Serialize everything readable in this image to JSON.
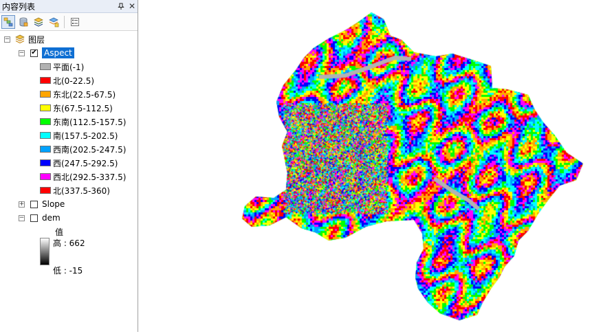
{
  "panel": {
    "title": "内容列表",
    "pin_icon": "pin-icon",
    "close_icon": "close-icon"
  },
  "toolbar": {
    "buttons": [
      {
        "name": "list-by-drawing-order",
        "icon": "drawing-order-icon",
        "active": true
      },
      {
        "name": "list-by-source",
        "icon": "source-icon",
        "active": false
      },
      {
        "name": "list-by-visibility",
        "icon": "visibility-icon",
        "active": false
      },
      {
        "name": "list-by-selection",
        "icon": "selection-icon",
        "active": false
      },
      {
        "name": "options",
        "icon": "options-icon",
        "active": false
      }
    ]
  },
  "tree": {
    "root": {
      "label": "图层",
      "expanded": true
    },
    "layers": [
      {
        "name": "Aspect",
        "checked": true,
        "expanded": true,
        "selected": true,
        "classes": [
          {
            "label": "平面(-1)",
            "color": "#b2b2b2"
          },
          {
            "label": "北(0-22.5)",
            "color": "#ff0000"
          },
          {
            "label": "东北(22.5-67.5)",
            "color": "#ffa500"
          },
          {
            "label": "东(67.5-112.5)",
            "color": "#ffff00"
          },
          {
            "label": "东南(112.5-157.5)",
            "color": "#00ff00"
          },
          {
            "label": "南(157.5-202.5)",
            "color": "#00ffff"
          },
          {
            "label": "西南(202.5-247.5)",
            "color": "#00a2ff"
          },
          {
            "label": "西(247.5-292.5)",
            "color": "#0000ff"
          },
          {
            "label": "西北(292.5-337.5)",
            "color": "#ff00ff"
          },
          {
            "label": "北(337.5-360)",
            "color": "#ff0000"
          }
        ]
      },
      {
        "name": "Slope",
        "checked": false,
        "expanded": false,
        "selected": false
      },
      {
        "name": "dem",
        "checked": false,
        "expanded": true,
        "selected": false,
        "legend": {
          "title": "值",
          "high": "高 : 662",
          "low": "低 : -15"
        }
      }
    ]
  },
  "map": {
    "layer": "Aspect",
    "colors": [
      "#ff0000",
      "#ffa500",
      "#ffff00",
      "#00ff00",
      "#00ffff",
      "#00a2ff",
      "#0000ff",
      "#ff00ff",
      "#b2b2b2"
    ]
  }
}
